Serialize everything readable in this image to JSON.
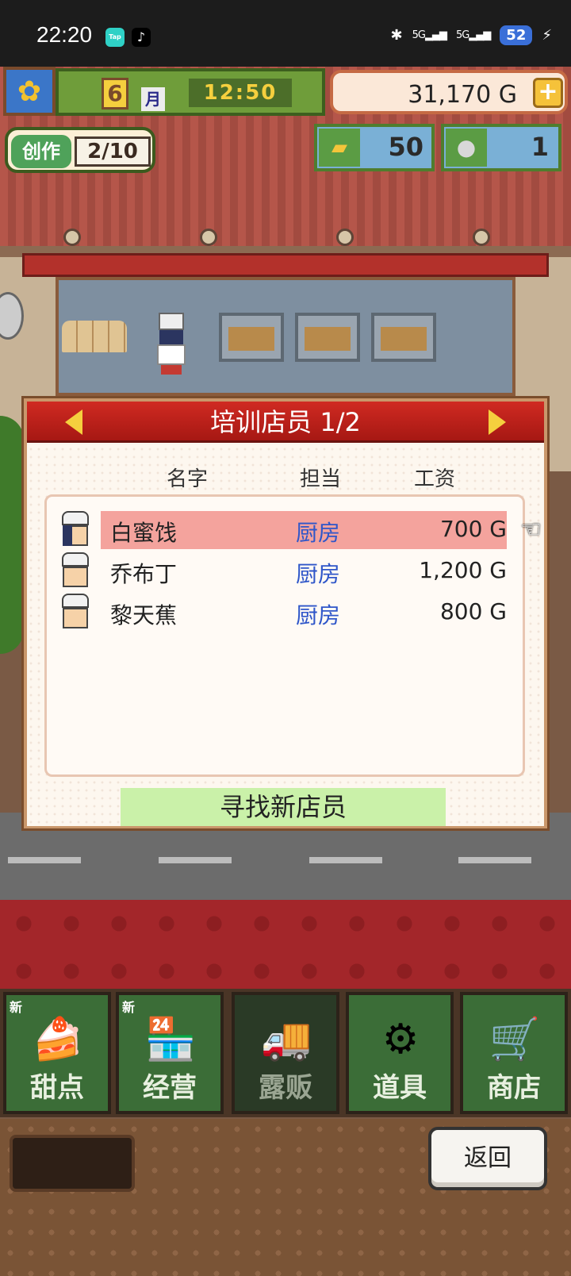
{
  "status_bar": {
    "time": "22:20",
    "app1": "Tap",
    "app2": "♪",
    "bluetooth": "✱",
    "signal1": "5G",
    "signal2": "5G",
    "battery": "52",
    "charging": "⚡"
  },
  "hud": {
    "flower_icon": "sunflower-icon",
    "month_number": "6",
    "month_label": "月",
    "clock": "12:50",
    "money": "31,170 G",
    "plus": "+",
    "create_label": "创作",
    "create_progress": "2/10",
    "gold_count": "50",
    "medal_count": "1"
  },
  "dialog": {
    "title": "培训店员 1/2",
    "columns": {
      "name": "名字",
      "role": "担当",
      "wage": "工资"
    },
    "rows": [
      {
        "name": "白蜜饯",
        "role": "厨房",
        "wage": "700 G",
        "selected": true
      },
      {
        "name": "乔布丁",
        "role": "厨房",
        "wage": "1,200 G",
        "selected": false
      },
      {
        "name": "黎天蕉",
        "role": "厨房",
        "wage": "800 G",
        "selected": false
      }
    ],
    "find_button": "寻找新店员"
  },
  "nav": {
    "items": [
      {
        "label": "甜点",
        "badge": "新",
        "icon": "cake-icon"
      },
      {
        "label": "经营",
        "badge": "新",
        "icon": "shop-icon"
      },
      {
        "label": "露贩",
        "badge": "",
        "icon": "food-truck-icon"
      },
      {
        "label": "道具",
        "badge": "",
        "icon": "tools-icon"
      },
      {
        "label": "商店",
        "badge": "",
        "icon": "cart-icon"
      }
    ]
  },
  "footer": {
    "back_button": "返回"
  },
  "colors": {
    "dialog_header": "#c0211b",
    "selected_row": "#f4a39d",
    "role_text": "#2f56c9",
    "find_button": "#caf1a9"
  }
}
